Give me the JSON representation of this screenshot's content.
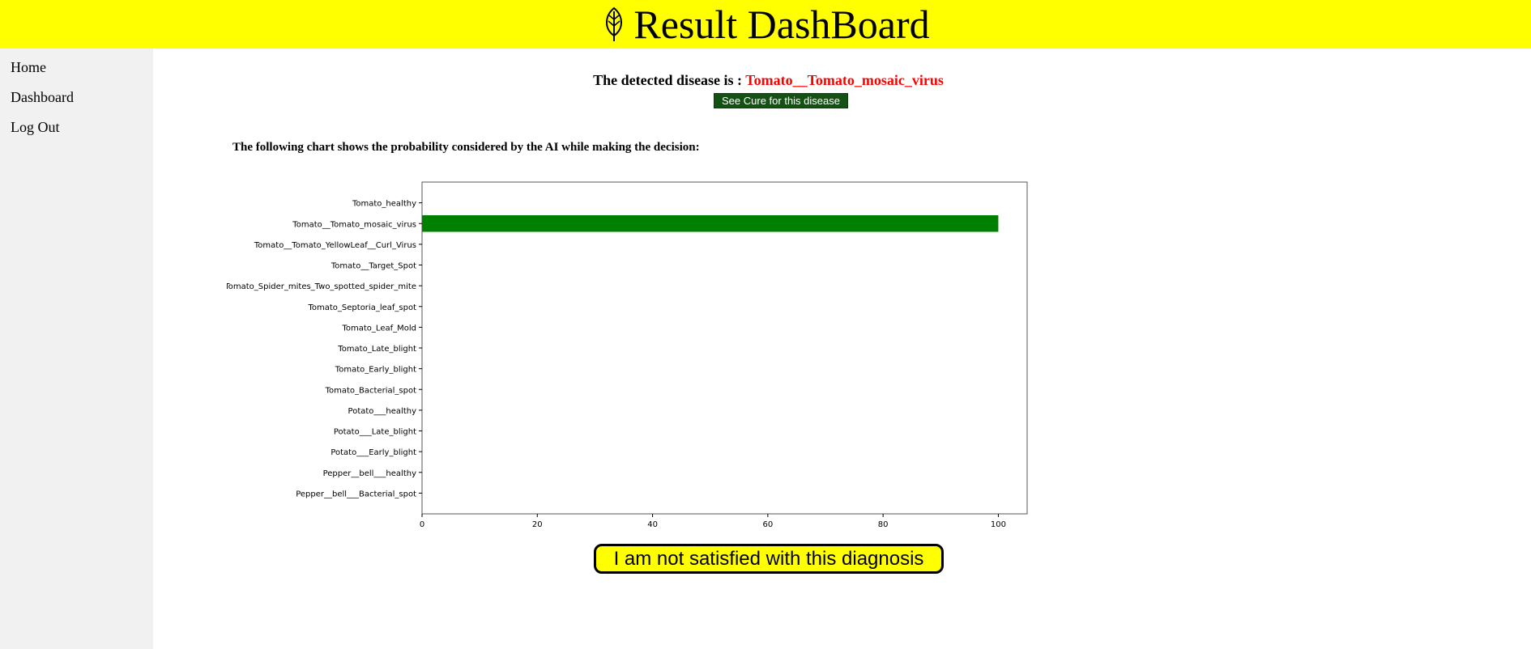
{
  "header": {
    "title": "Result DashBoard",
    "icon": "leaf-icon",
    "background": "#ffff00"
  },
  "sidebar": {
    "items": [
      {
        "label": "Home"
      },
      {
        "label": "Dashboard"
      },
      {
        "label": "Log Out"
      }
    ]
  },
  "result": {
    "prefix": "The detected disease is : ",
    "disease": "Tomato__Tomato_mosaic_virus",
    "disease_color": "#ff0000"
  },
  "cure_button": {
    "label": "See Cure for this disease",
    "color": "#145214"
  },
  "chart_intro": "The following chart shows the probability considered by the AI while making the decision:",
  "chart_data": {
    "type": "bar",
    "orientation": "horizontal",
    "categories": [
      "Tomato_healthy",
      "Tomato__Tomato_mosaic_virus",
      "Tomato__Tomato_YellowLeaf__Curl_Virus",
      "Tomato__Target_Spot",
      "Tomato_Spider_mites_Two_spotted_spider_mite",
      "Tomato_Septoria_leaf_spot",
      "Tomato_Leaf_Mold",
      "Tomato_Late_blight",
      "Tomato_Early_blight",
      "Tomato_Bacterial_spot",
      "Potato___healthy",
      "Potato___Late_blight",
      "Potato___Early_blight",
      "Pepper__bell___healthy",
      "Pepper__bell___Bacterial_spot"
    ],
    "values": [
      0,
      100,
      0,
      0,
      0,
      0,
      0,
      0,
      0,
      0,
      0,
      0,
      0,
      0,
      0
    ],
    "xlim": [
      0,
      105
    ],
    "xticks": [
      0,
      20,
      40,
      60,
      80,
      100
    ],
    "bar_color": "#008000",
    "grid": false,
    "title": "",
    "xlabel": "",
    "ylabel": ""
  },
  "feedback_button": {
    "label": "I am not satisfied with this diagnosis",
    "color": "#ffff00"
  }
}
